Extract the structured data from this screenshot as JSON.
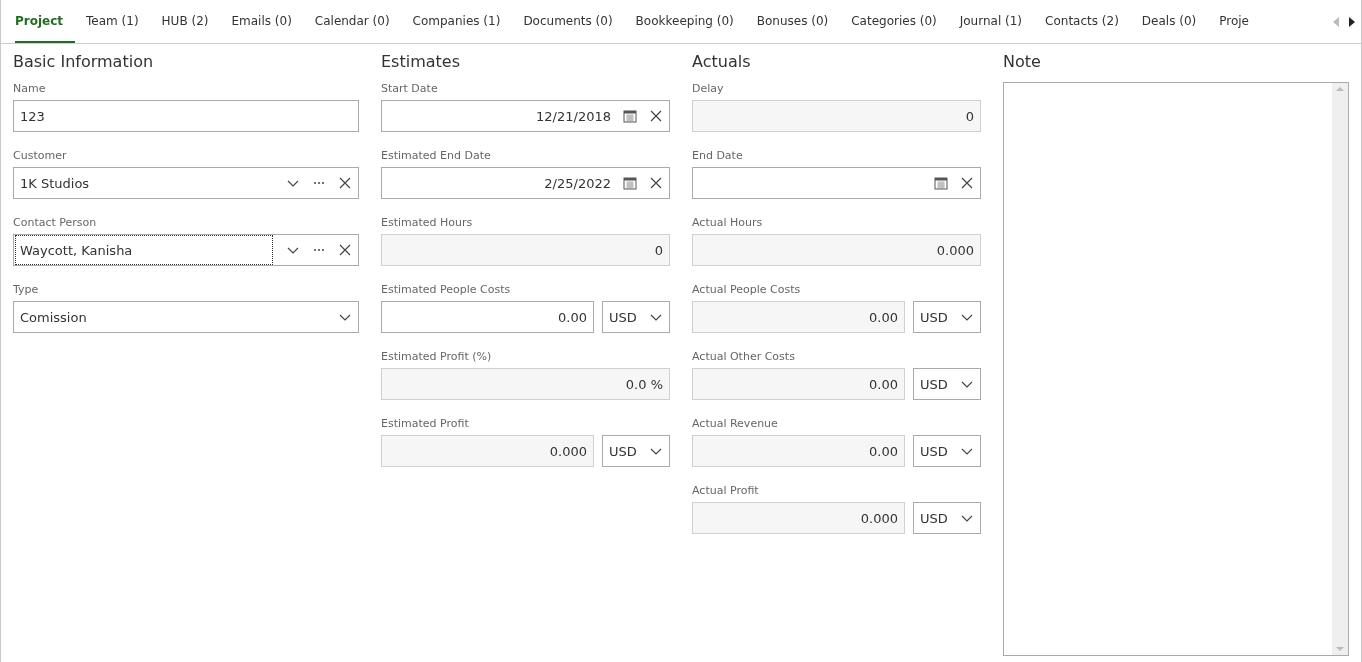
{
  "tabs": [
    {
      "label": "Project",
      "selected": true
    },
    {
      "label": "Team (1)",
      "selected": false
    },
    {
      "label": "HUB (2)",
      "selected": false
    },
    {
      "label": "Emails (0)",
      "selected": false
    },
    {
      "label": "Calendar (0)",
      "selected": false
    },
    {
      "label": "Companies (1)",
      "selected": false
    },
    {
      "label": "Documents (0)",
      "selected": false
    },
    {
      "label": "Bookkeeping (0)",
      "selected": false
    },
    {
      "label": "Bonuses (0)",
      "selected": false
    },
    {
      "label": "Categories (0)",
      "selected": false
    },
    {
      "label": "Journal (1)",
      "selected": false
    },
    {
      "label": "Contacts (2)",
      "selected": false
    },
    {
      "label": "Deals (0)",
      "selected": false
    },
    {
      "label": "Proje",
      "selected": false
    }
  ],
  "tab_scroll": {
    "left_disabled": true,
    "right_disabled": false
  },
  "sections": [
    {
      "title": "Basic Information",
      "fields": [
        {
          "kind": "text",
          "label": "Name",
          "value": "123",
          "disabled": false,
          "focused": false
        },
        {
          "kind": "lookup",
          "label": "Customer",
          "value": "1K Studios",
          "disabled": false,
          "focused": false
        },
        {
          "kind": "lookup",
          "label": "Contact Person",
          "value": "Waycott, Kanisha",
          "disabled": false,
          "focused": true
        },
        {
          "kind": "select",
          "label": "Type",
          "value": "Comission",
          "disabled": false,
          "focused": false
        }
      ]
    },
    {
      "title": "Estimates",
      "fields": [
        {
          "kind": "date",
          "label": "Start Date",
          "value": "12/21/2018",
          "disabled": false,
          "focused": false
        },
        {
          "kind": "date",
          "label": "Estimated End Date",
          "value": "2/25/2022",
          "disabled": false,
          "focused": false
        },
        {
          "kind": "number",
          "label": "Estimated Hours",
          "value": "0",
          "disabled": true,
          "focused": false
        },
        {
          "kind": "money",
          "label": "Estimated People Costs",
          "value": "0.00",
          "currency": "USD",
          "disabled": false,
          "focused": false
        },
        {
          "kind": "number",
          "label": "Estimated Profit (%)",
          "value": "0.0 %",
          "disabled": true,
          "focused": false
        },
        {
          "kind": "money",
          "label": "Estimated Profit",
          "value": "0.000",
          "currency": "USD",
          "disabled": true,
          "focused": false
        }
      ]
    },
    {
      "title": "Actuals",
      "fields": [
        {
          "kind": "number",
          "label": "Delay",
          "value": "0",
          "disabled": true,
          "focused": false
        },
        {
          "kind": "date",
          "label": "End Date",
          "disabled": false,
          "focused": false
        },
        {
          "kind": "number",
          "label": "Actual Hours",
          "value": "0.000",
          "disabled": true,
          "focused": false
        },
        {
          "kind": "money",
          "label": "Actual People Costs",
          "value": "0.00",
          "currency": "USD",
          "disabled": true,
          "focused": false
        },
        {
          "kind": "money",
          "label": "Actual Other Costs",
          "value": "0.00",
          "currency": "USD",
          "disabled": true,
          "focused": false
        },
        {
          "kind": "money",
          "label": "Actual Revenue",
          "value": "0.00",
          "currency": "USD",
          "disabled": true,
          "focused": false
        },
        {
          "kind": "money",
          "label": "Actual Profit",
          "value": "0.000",
          "currency": "USD",
          "disabled": true,
          "focused": false
        }
      ]
    }
  ],
  "note": {
    "title": "Note"
  }
}
